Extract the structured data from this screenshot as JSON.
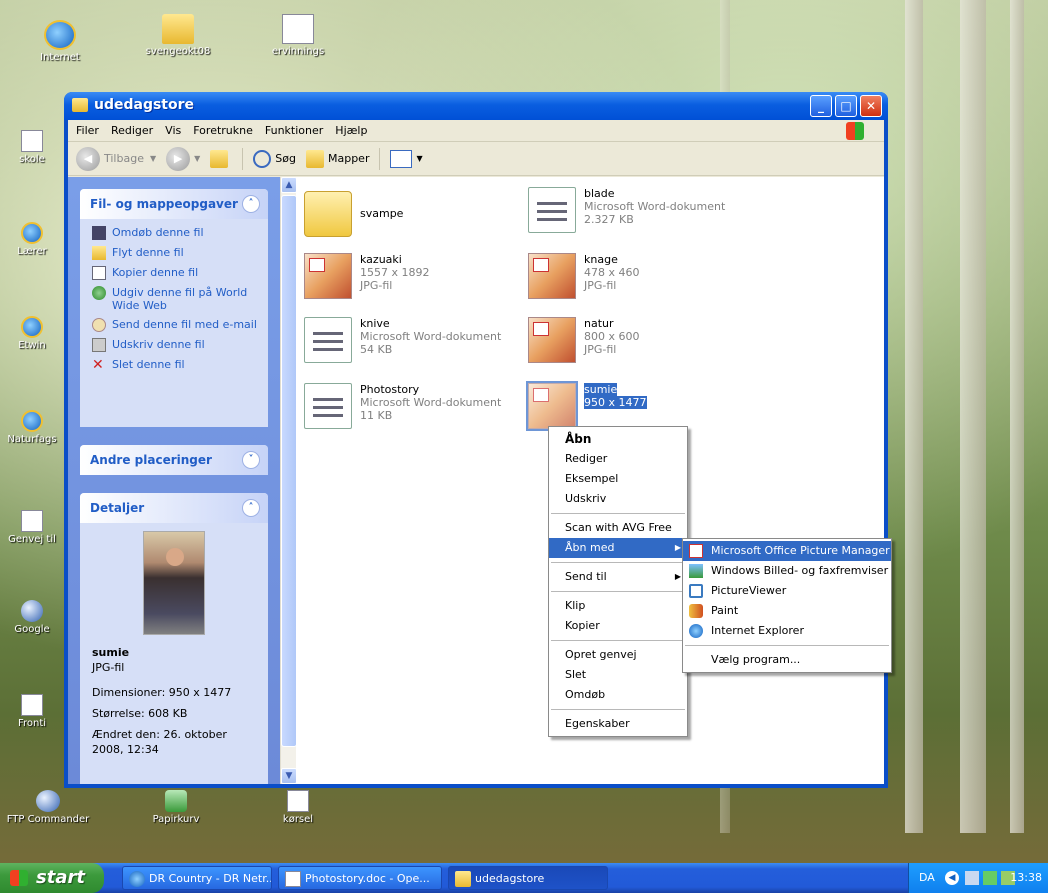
{
  "desktop": {
    "icons": [
      {
        "label": "Internet"
      },
      {
        "label": "svengeokt08"
      },
      {
        "label": "ervinnings"
      },
      {
        "label": "skole"
      },
      {
        "label": "Lærer"
      },
      {
        "label": "Etwin"
      },
      {
        "label": "Naturfags"
      },
      {
        "label": "Genvej til"
      },
      {
        "label": "Google"
      },
      {
        "label": "Fronti"
      },
      {
        "label": "FTP Commander"
      },
      {
        "label": "Papirkurv"
      },
      {
        "label": "kørsel"
      }
    ]
  },
  "window": {
    "title": "udedagstore",
    "buttons": {
      "minimize": "_",
      "maximize": "□",
      "close": "✕"
    },
    "menu": [
      "Filer",
      "Rediger",
      "Vis",
      "Foretrukne",
      "Funktioner",
      "Hjælp"
    ],
    "toolbar": {
      "back": "Tilbage",
      "search": "Søg",
      "folders": "Mapper"
    }
  },
  "tasks_panel": {
    "title": "Fil- og mappeopgaver",
    "items": [
      {
        "label": "Omdøb denne fil",
        "icon": "rename-icon"
      },
      {
        "label": "Flyt denne fil",
        "icon": "move-icon"
      },
      {
        "label": "Kopier denne fil",
        "icon": "copy-icon"
      },
      {
        "label": "Udgiv denne fil på World Wide Web",
        "icon": "globe-icon"
      },
      {
        "label": "Send denne fil med e-mail",
        "icon": "email-icon"
      },
      {
        "label": "Udskriv denne fil",
        "icon": "print-icon"
      },
      {
        "label": "Slet denne fil",
        "icon": "delete-icon"
      }
    ]
  },
  "other_places": {
    "title": "Andre placeringer"
  },
  "details": {
    "title": "Detaljer",
    "name": "sumie",
    "type": "JPG-fil",
    "dimensions": "Dimensioner: 950 x 1477",
    "size": "Størrelse: 608 KB",
    "modified": "Ændret den: 26. oktober 2008, 12:34"
  },
  "files": [
    {
      "name": "svampe",
      "kind": "folder",
      "line2": "",
      "line3": ""
    },
    {
      "name": "blade",
      "kind": "word",
      "line2": "Microsoft Word-dokument",
      "line3": "2.327 KB"
    },
    {
      "name": "kazuaki",
      "kind": "image",
      "line2": "1557 x 1892",
      "line3": "JPG-fil"
    },
    {
      "name": "knage",
      "kind": "image",
      "line2": "478 x 460",
      "line3": "JPG-fil"
    },
    {
      "name": "knive",
      "kind": "word",
      "line2": "Microsoft Word-dokument",
      "line3": "54 KB"
    },
    {
      "name": "natur",
      "kind": "image",
      "line2": "800 x 600",
      "line3": "JPG-fil"
    },
    {
      "name": "Photostory",
      "kind": "word",
      "line2": "Microsoft Word-dokument",
      "line3": "11 KB"
    },
    {
      "name": "sumie",
      "kind": "image",
      "line2": "950 x 1477",
      "line3": ""
    }
  ],
  "context_menu": {
    "items": [
      "Åbn",
      "Rediger",
      "Eksempel",
      "Udskriv",
      "Scan with AVG Free",
      "Åbn med",
      "Send til",
      "Klip",
      "Kopier",
      "Opret genvej",
      "Slet",
      "Omdøb",
      "Egenskaber"
    ],
    "highlighted": "Åbn med"
  },
  "open_with_menu": {
    "items": [
      {
        "label": "Microsoft Office Picture Manager",
        "icon": "picture-manager-icon"
      },
      {
        "label": "Windows Billed- og faxfremviser",
        "icon": "image-viewer-icon"
      },
      {
        "label": "PictureViewer",
        "icon": "pictureviewer-icon"
      },
      {
        "label": "Paint",
        "icon": "paint-icon"
      },
      {
        "label": "Internet Explorer",
        "icon": "internet-explorer-icon"
      },
      {
        "label": "Vælg program...",
        "icon": ""
      }
    ],
    "highlighted": "Microsoft Office Picture Manager"
  },
  "taskbar": {
    "start": "start",
    "tasks": [
      {
        "label": "DR Country - DR Netr..."
      },
      {
        "label": "Photostory.doc - Ope..."
      },
      {
        "label": "udedagstore"
      }
    ],
    "lang": "DA",
    "clock": "13:38"
  },
  "colors": {
    "xp_blue": "#0a4ec8",
    "selection": "#316ac5",
    "task_link": "#215dc6"
  }
}
